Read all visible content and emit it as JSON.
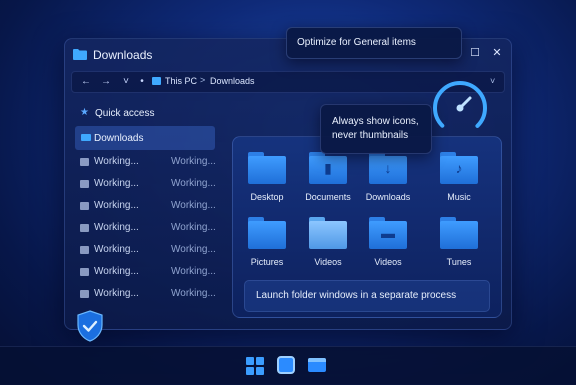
{
  "window": {
    "title": "Downloads",
    "controls": {
      "maximize": "☐",
      "close": "✕"
    }
  },
  "navbar": {
    "back": "←",
    "forward": "→",
    "dropdown": "˅",
    "dot": "•",
    "breadcrumb": [
      "This PC",
      "Downloads"
    ],
    "separator": ">",
    "chevron": "˅"
  },
  "sidebar": {
    "quick_access": "Quick access",
    "selected": "Downloads",
    "rows": [
      {
        "label": "Working...",
        "status": "Working..."
      },
      {
        "label": "Working...",
        "status": "Working..."
      },
      {
        "label": "Working...",
        "status": "Working..."
      },
      {
        "label": "Working...",
        "status": "Working..."
      },
      {
        "label": "Working...",
        "status": "Working..."
      },
      {
        "label": "Working...",
        "status": "Working..."
      },
      {
        "label": "Working...",
        "status": "Working..."
      }
    ]
  },
  "tooltips": {
    "optimize": "Optimize for General items",
    "icons_line1": "Always show icons,",
    "icons_line2": "never thumbnails"
  },
  "folders": [
    {
      "label": "Desktop",
      "icon": "desktop-folder-icon",
      "glyph": ""
    },
    {
      "label": "Documents",
      "icon": "documents-folder-icon",
      "glyph": "▮"
    },
    {
      "label": "Downloads",
      "icon": "downloads-folder-icon",
      "glyph": "↓"
    },
    {
      "label": "Music",
      "icon": "music-folder-icon",
      "glyph": "♪"
    },
    {
      "label": "Pictures",
      "icon": "pictures-folder-icon",
      "glyph": ""
    },
    {
      "label": "Videos",
      "icon": "videos-folder-icon",
      "glyph": ""
    },
    {
      "label": "Videos",
      "icon": "videos-folder-icon",
      "glyph": "▬"
    },
    {
      "label": "Tunes",
      "icon": "tunes-folder-icon",
      "glyph": ""
    }
  ],
  "launch_option": "Launch folder windows in a separate process",
  "colors": {
    "accent": "#3fa9ff",
    "background": "#0f2a78"
  }
}
